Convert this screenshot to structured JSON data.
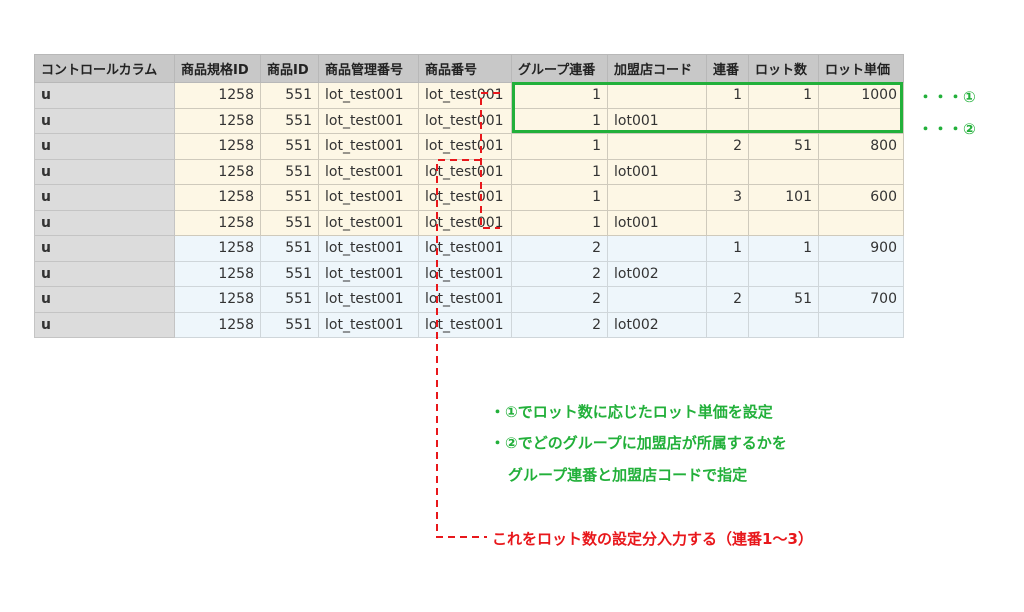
{
  "table": {
    "headers": [
      "コントロールカラム",
      "商品規格ID",
      "商品ID",
      "商品管理番号",
      "商品番号",
      "グループ連番",
      "加盟店コード",
      "連番",
      "ロット数",
      "ロット単価"
    ],
    "rows": [
      {
        "group": 1,
        "cells": [
          "u",
          "1258",
          "551",
          "lot_test001",
          "lot_test001",
          "1",
          "",
          "1",
          "1",
          "1000"
        ]
      },
      {
        "group": 1,
        "cells": [
          "u",
          "1258",
          "551",
          "lot_test001",
          "lot_test001",
          "1",
          "lot001",
          "",
          "",
          ""
        ]
      },
      {
        "group": 1,
        "cells": [
          "u",
          "1258",
          "551",
          "lot_test001",
          "lot_test001",
          "1",
          "",
          "2",
          "51",
          "800"
        ]
      },
      {
        "group": 1,
        "cells": [
          "u",
          "1258",
          "551",
          "lot_test001",
          "lot_test001",
          "1",
          "lot001",
          "",
          "",
          ""
        ]
      },
      {
        "group": 1,
        "cells": [
          "u",
          "1258",
          "551",
          "lot_test001",
          "lot_test001",
          "1",
          "",
          "3",
          "101",
          "600"
        ]
      },
      {
        "group": 1,
        "cells": [
          "u",
          "1258",
          "551",
          "lot_test001",
          "lot_test001",
          "1",
          "lot001",
          "",
          "",
          ""
        ]
      },
      {
        "group": 2,
        "cells": [
          "u",
          "1258",
          "551",
          "lot_test001",
          "lot_test001",
          "2",
          "",
          "1",
          "1",
          "900"
        ]
      },
      {
        "group": 2,
        "cells": [
          "u",
          "1258",
          "551",
          "lot_test001",
          "lot_test001",
          "2",
          "lot002",
          "",
          "",
          ""
        ]
      },
      {
        "group": 2,
        "cells": [
          "u",
          "1258",
          "551",
          "lot_test001",
          "lot_test001",
          "2",
          "",
          "2",
          "51",
          "700"
        ]
      },
      {
        "group": 2,
        "cells": [
          "u",
          "1258",
          "551",
          "lot_test001",
          "lot_test001",
          "2",
          "lot002",
          "",
          "",
          ""
        ]
      }
    ]
  },
  "annotations": {
    "mark1": "・・・①",
    "mark2": "・・・②",
    "note1": "・①でロット数に応じたロット単価を設定",
    "note2": "・②でどのグループに加盟店が所属するかを",
    "note3": "グループ連番と加盟店コードで指定",
    "red_note": "これをロット数の設定分入力する（連番1〜3）"
  },
  "colors": {
    "green": "#22b03a",
    "red": "#e8171b"
  }
}
